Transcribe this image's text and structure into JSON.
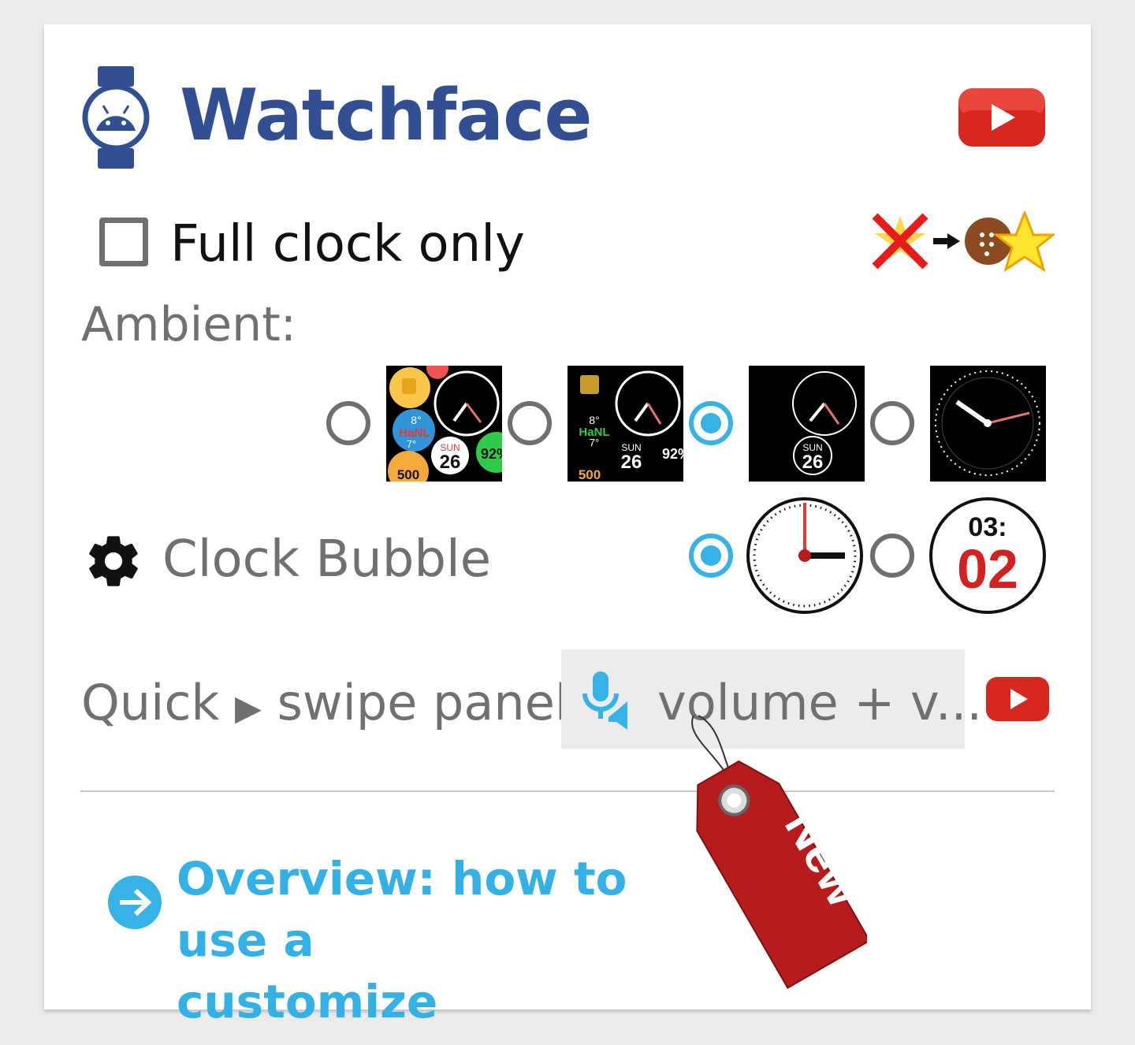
{
  "header": {
    "title": "Watchface",
    "icon": "watch-android-icon",
    "video_icon": "youtube-play-icon"
  },
  "full_clock": {
    "label": "Full clock only",
    "checked": false,
    "badge_icon": "remove-favorite-to-star-icon"
  },
  "ambient": {
    "label": "Ambient:",
    "options": [
      {
        "selected": false,
        "preview": {
          "temp_high": "8°",
          "location": "HaNL",
          "temp_low": "7°",
          "day": "SUN",
          "date": "26",
          "battery": "92%",
          "steps": "500"
        }
      },
      {
        "selected": false,
        "preview": {
          "temp_high": "8°",
          "location": "HaNL",
          "temp_low": "7°",
          "day": "SUN",
          "date": "26",
          "battery": "92%",
          "steps": "500"
        }
      },
      {
        "selected": true,
        "preview": {
          "day": "SUN",
          "date": "26"
        }
      },
      {
        "selected": false,
        "preview": {}
      }
    ]
  },
  "clock_bubble": {
    "label": "Clock Bubble",
    "settings_icon": "gear-icon",
    "options": [
      {
        "selected": true,
        "type": "analog"
      },
      {
        "selected": false,
        "type": "digital",
        "hour": "03:",
        "minute": "02"
      }
    ]
  },
  "quick_panel": {
    "label_part1": "Quick",
    "arrow": "▶",
    "label_part2": "swipe panel",
    "dropdown_value": "volume + v...",
    "dropdown_icon": "mic-volume-icon",
    "video_icon": "youtube-play-icon",
    "new_tag": "New"
  },
  "overview": {
    "icon": "arrow-circle-icon",
    "link_text": "Overview: how to use and customize",
    "line1": "Overview: how to use a",
    "line2": "customize"
  },
  "colors": {
    "title_blue": "#324f93",
    "accent_blue": "#36b2e6",
    "youtube_red": "#d8261e",
    "tag_red": "#b71c1c"
  }
}
